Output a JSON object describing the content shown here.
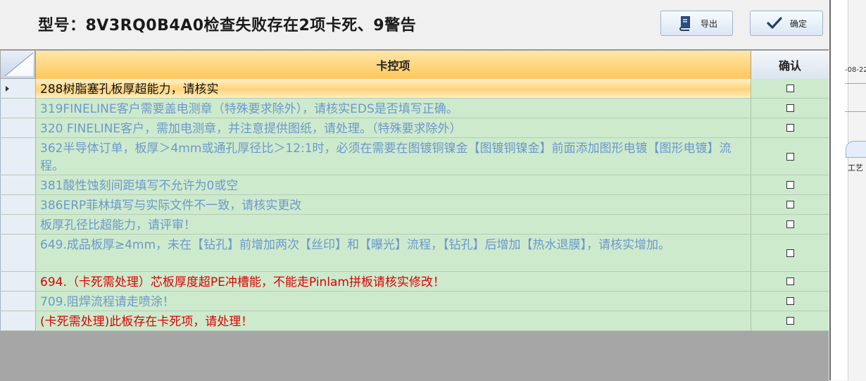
{
  "dialog": {
    "title": "型号：8V3RQ0B4A0检查失败存在2项卡死、9警告",
    "export_label": "导出",
    "ok_label": "确定"
  },
  "grid": {
    "col_main": "卡控项",
    "col_confirm": "确认",
    "rows": [
      {
        "text": "288树脂塞孔板厚超能力，请核实",
        "color": "#111111",
        "checked": false,
        "selected": true
      },
      {
        "text": "319FINELINE客户需要盖电测章（特殊要求除外），请核实EDS是否填写正确。",
        "color": "#6e98cc",
        "checked": false
      },
      {
        "text": "320 FINELINE客户，需加电测章，并注意提供图纸，请处理。（特殊要求除外）",
        "color": "#6e98cc",
        "checked": false
      },
      {
        "text": "362半导体订单，板厚＞4mm或通孔厚径比＞12:1时，必须在需要在图镀铜镍金【图镀铜镍金】前面添加图形电镀【图形电镀】流程。",
        "color": "#6e98cc",
        "checked": false
      },
      {
        "text": "381酸性蚀刻间距填写不允许为0或空",
        "color": "#6e98cc",
        "checked": false
      },
      {
        "text": "386ERP菲林填写与实际文件不一致，请核实更改",
        "color": "#6e98cc",
        "checked": false
      },
      {
        "text": "板厚孔径比超能力，请评审！",
        "color": "#6e98cc",
        "checked": false
      },
      {
        "text": "649.成品板厚≥4mm，未在【钻孔】前增加两次【丝印】和【曝光】流程，【钻孔】后增加【热水退膜】，请核实增加。",
        "color": "#6e98cc",
        "checked": false
      },
      {
        "text": "694.（卡死需处理）芯板厚度超PE冲槽能，不能走Pinlam拼板请核实修改！",
        "color": "#e00000",
        "checked": false
      },
      {
        "text": "709.阻焊流程请走喷涂！",
        "color": "#6e98cc",
        "checked": false
      },
      {
        "text": "(卡死需处理)此板存在卡死项，请处理！",
        "color": "#e00000",
        "checked": false
      }
    ]
  },
  "background": {
    "date_fragment": "-08-22",
    "tab_fragment": "工艺"
  }
}
